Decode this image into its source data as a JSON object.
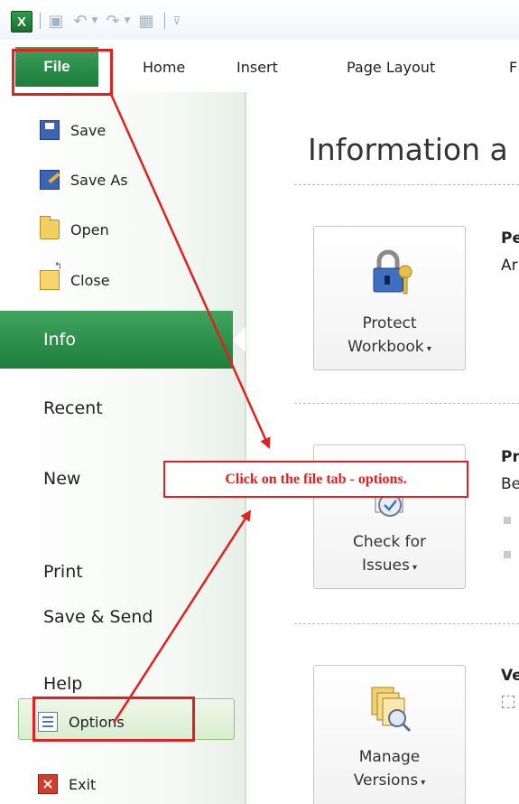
{
  "ribbon": {
    "file_tab": "File",
    "tabs": [
      "Home",
      "Insert",
      "Page Layout",
      "F"
    ]
  },
  "backstage": {
    "commands": [
      "Save",
      "Save As",
      "Open",
      "Close"
    ],
    "info": "Info",
    "nav": [
      "Recent",
      "New",
      "Print",
      "Save & Send",
      "Help"
    ],
    "options": "Options",
    "exit": "Exit"
  },
  "content": {
    "title": "Information a",
    "protect_line1": "Protect",
    "protect_line2": "Workbook",
    "protect_heading": "Pe",
    "protect_sub": "Ar",
    "check_line1": "Check for",
    "check_line2": "Issues",
    "check_heading": "Pr",
    "check_sub": "Be",
    "manage_line1": "Manage",
    "manage_line2": "Versions",
    "manage_heading": "Ve"
  },
  "annotation": {
    "callout": "Click on the file tab - options."
  },
  "colors": {
    "accent_green": "#1e7d3b",
    "annotation_red": "#e32020"
  }
}
